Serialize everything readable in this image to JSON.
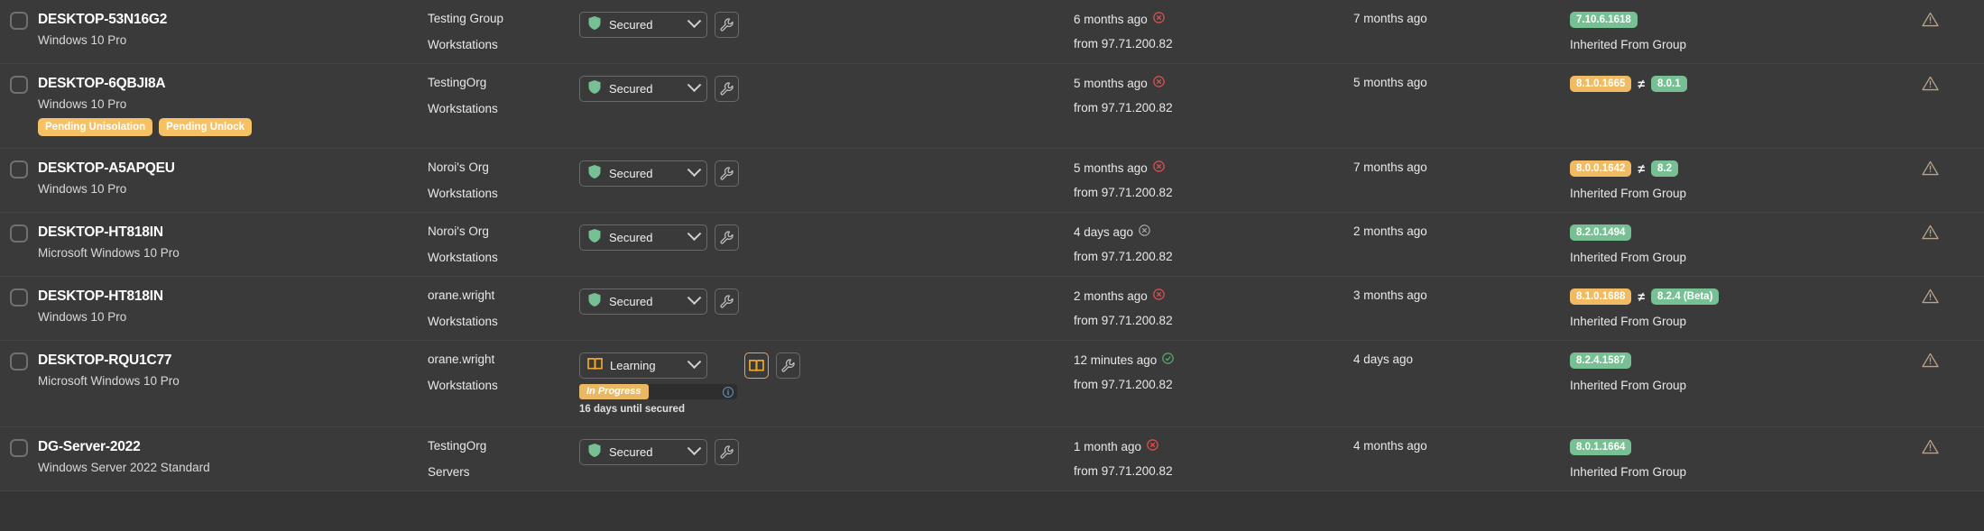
{
  "icons": {
    "checkbox": "checkbox-icon",
    "shield": "shield-icon",
    "book": "book-icon",
    "wrench": "wrench-icon",
    "chevron_down": "chevron-down-icon",
    "info": "info-icon",
    "warning": "warning-triangle-icon",
    "status_error": "error-circle-icon",
    "status_ok": "check-circle-icon",
    "status_neutral": "neutral-circle-icon",
    "not_equal": "≠"
  },
  "colors": {
    "badge_green": "#76c093",
    "badge_amber": "#f0bb62",
    "tag_amber": "#f5c164",
    "accent_orange": "#f0a828",
    "error_red": "#e05252",
    "success_green": "#5aa86f",
    "row_bg": "#3a3a3a",
    "row_border": "#454545"
  },
  "rows": [
    {
      "hostname": "DESKTOP-53N16G2",
      "os": "Windows 10 Pro",
      "tags": [],
      "group_name": "Testing Group",
      "group_type": "Workstations",
      "state": {
        "label": "Secured",
        "icon": "shield-icon",
        "type": "secured"
      },
      "progress": null,
      "last_seen": "6 months ago",
      "last_seen_status": "error",
      "last_seen_ip": "from 97.71.200.82",
      "updated": "7 months ago",
      "versions": [
        {
          "text": "7.10.6.1618",
          "color": "green"
        }
      ],
      "version_mismatch": false,
      "inherited": "Inherited From Group",
      "warning": true
    },
    {
      "hostname": "DESKTOP-6QBJI8A",
      "os": "Windows 10 Pro",
      "tags": [
        "Pending Unisolation",
        "Pending Unlock"
      ],
      "group_name": "TestingOrg",
      "group_type": "Workstations",
      "state": {
        "label": "Secured",
        "icon": "shield-icon",
        "type": "secured"
      },
      "progress": null,
      "last_seen": "5 months ago",
      "last_seen_status": "error",
      "last_seen_ip": "from 97.71.200.82",
      "updated": "5 months ago",
      "versions": [
        {
          "text": "8.1.0.1665",
          "color": "amber"
        },
        {
          "text": "8.0.1",
          "color": "green"
        }
      ],
      "version_mismatch": true,
      "inherited": "",
      "warning": true
    },
    {
      "hostname": "DESKTOP-A5APQEU",
      "os": "Windows 10 Pro",
      "tags": [],
      "group_name": "Noroi's Org",
      "group_type": "Workstations",
      "state": {
        "label": "Secured",
        "icon": "shield-icon",
        "type": "secured"
      },
      "progress": null,
      "last_seen": "5 months ago",
      "last_seen_status": "error",
      "last_seen_ip": "from 97.71.200.82",
      "updated": "7 months ago",
      "versions": [
        {
          "text": "8.0.0.1642",
          "color": "amber"
        },
        {
          "text": "8.2",
          "color": "green"
        }
      ],
      "version_mismatch": true,
      "inherited": "Inherited From Group",
      "warning": true
    },
    {
      "hostname": "DESKTOP-HT818IN",
      "os": "Microsoft Windows 10 Pro",
      "tags": [],
      "group_name": "Noroi's Org",
      "group_type": "Workstations",
      "state": {
        "label": "Secured",
        "icon": "shield-icon",
        "type": "secured"
      },
      "progress": null,
      "last_seen": "4 days ago",
      "last_seen_status": "neutral",
      "last_seen_ip": "from 97.71.200.82",
      "updated": "2 months ago",
      "versions": [
        {
          "text": "8.2.0.1494",
          "color": "green"
        }
      ],
      "version_mismatch": false,
      "inherited": "Inherited From Group",
      "warning": true
    },
    {
      "hostname": "DESKTOP-HT818IN",
      "os": "Windows 10 Pro",
      "tags": [],
      "group_name": "orane.wright",
      "group_type": "Workstations",
      "state": {
        "label": "Secured",
        "icon": "shield-icon",
        "type": "secured"
      },
      "progress": null,
      "last_seen": "2 months ago",
      "last_seen_status": "error",
      "last_seen_ip": "from 97.71.200.82",
      "updated": "3 months ago",
      "versions": [
        {
          "text": "8.1.0.1688",
          "color": "amber"
        },
        {
          "text": "8.2.4 (Beta)",
          "color": "green"
        }
      ],
      "version_mismatch": true,
      "inherited": "Inherited From Group",
      "warning": true
    },
    {
      "hostname": "DESKTOP-RQU1C77",
      "os": "Microsoft Windows 10 Pro",
      "tags": [],
      "group_name": "orane.wright",
      "group_type": "Workstations",
      "state": {
        "label": "Learning",
        "icon": "book-icon",
        "type": "learning"
      },
      "progress": {
        "label": "In Progress",
        "until": "16 days until secured"
      },
      "last_seen": "12 minutes ago",
      "last_seen_status": "ok",
      "last_seen_ip": "from 97.71.200.82",
      "updated": "4 days ago",
      "versions": [
        {
          "text": "8.2.4.1587",
          "color": "green"
        }
      ],
      "version_mismatch": false,
      "inherited": "Inherited From Group",
      "warning": true
    },
    {
      "hostname": "DG-Server-2022",
      "os": "Windows Server 2022 Standard",
      "tags": [],
      "group_name": "TestingOrg",
      "group_type": "Servers",
      "state": {
        "label": "Secured",
        "icon": "shield-icon",
        "type": "secured"
      },
      "progress": null,
      "last_seen": "1 month ago",
      "last_seen_status": "error",
      "last_seen_ip": "from 97.71.200.82",
      "updated": "4 months ago",
      "versions": [
        {
          "text": "8.0.1.1664",
          "color": "green"
        }
      ],
      "version_mismatch": false,
      "inherited": "Inherited From Group",
      "warning": true
    }
  ]
}
